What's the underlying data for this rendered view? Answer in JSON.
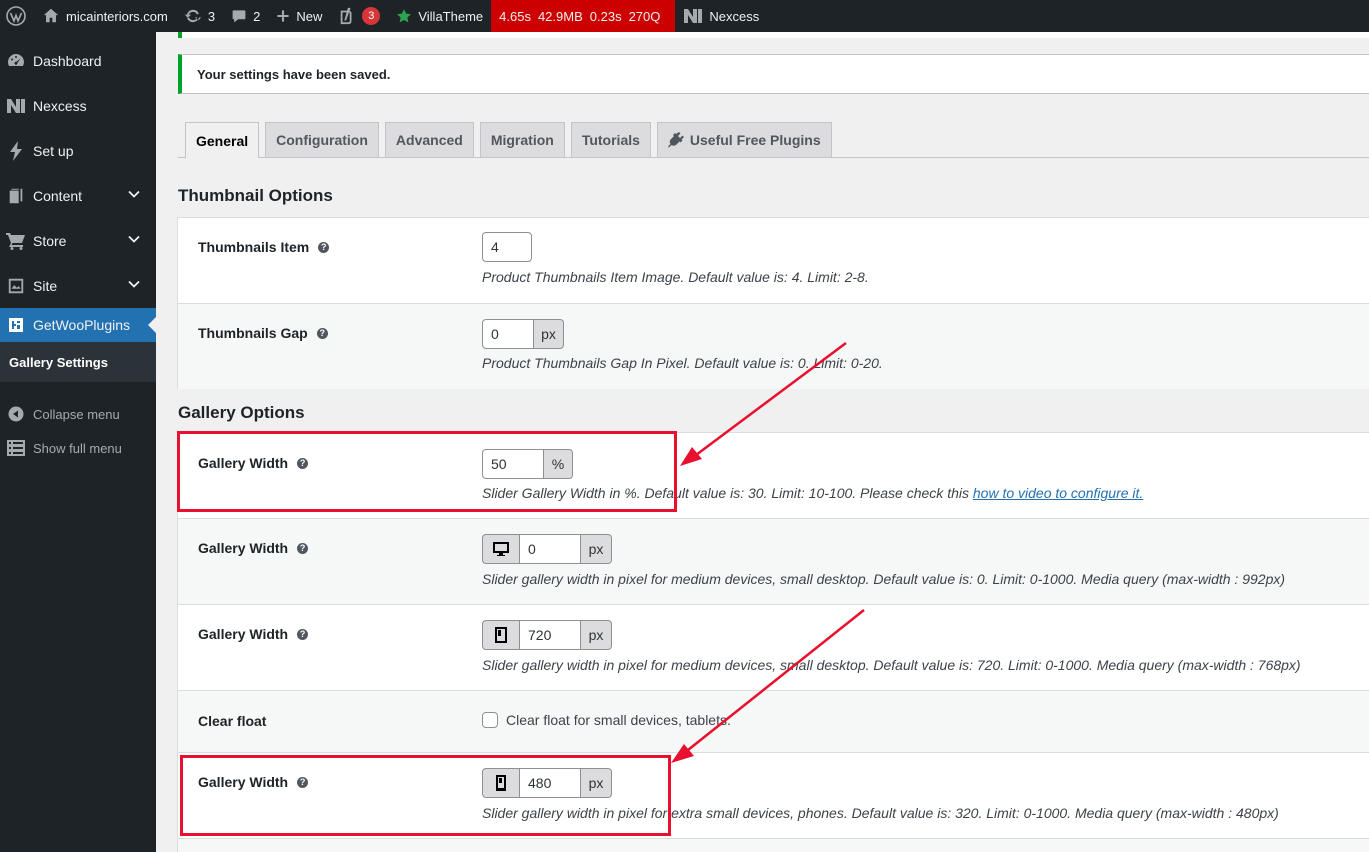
{
  "adminbar": {
    "site_name": "micainteriors.com",
    "updates_count": "3",
    "comments_count": "2",
    "new_label": "New",
    "yoast_badge": "3",
    "villatheme_label": "VillaTheme",
    "perf": [
      "4.65s",
      "42.9MB",
      "0.23s",
      "270Q"
    ],
    "nexcess_label": "Nexcess"
  },
  "sidebar": {
    "items": [
      {
        "label": "Dashboard",
        "icon": "dashboard-icon"
      },
      {
        "label": "Nexcess",
        "icon": "nexcess-icon"
      },
      {
        "label": "Set up",
        "icon": "bolt-icon"
      },
      {
        "label": "Content",
        "icon": "content-icon"
      },
      {
        "label": "Store",
        "icon": "cart-icon"
      },
      {
        "label": "Site",
        "icon": "site-icon"
      },
      {
        "label": "GetWooPlugins",
        "icon": "getwooplugins-icon"
      }
    ],
    "submenu_active": "Gallery Settings",
    "collapse_label": "Collapse menu",
    "full_menu_label": "Show full menu"
  },
  "notice": {
    "text": "Your settings have been saved."
  },
  "tabs": [
    "General",
    "Configuration",
    "Advanced",
    "Migration",
    "Tutorials",
    "Useful Free Plugins"
  ],
  "thumbnail_section": {
    "title": "Thumbnail Options",
    "rows": [
      {
        "label": "Thumbnails Item",
        "value": "4",
        "description": "Product Thumbnails Item Image. Default value is: 4. Limit: 2-8."
      },
      {
        "label": "Thumbnails Gap",
        "value": "0",
        "unit": "px",
        "description": "Product Thumbnails Gap In Pixel. Default value is: 0. Limit: 0-20."
      }
    ]
  },
  "gallery_section": {
    "title": "Gallery Options",
    "rows": [
      {
        "label": "Gallery Width",
        "value": "50",
        "unit": "%",
        "description": "Slider Gallery Width in %. Default value is: 30. Limit: 10-100. Please check this ",
        "link": "how to video to configure it."
      },
      {
        "label": "Gallery Width",
        "value": "0",
        "unit": "px",
        "icon": "desktop-icon",
        "description": "Slider gallery width in pixel for medium devices, small desktop. Default value is: 0. Limit: 0-1000. Media query (max-width : 992px)"
      },
      {
        "label": "Gallery Width",
        "value": "720",
        "unit": "px",
        "icon": "tablet-icon",
        "description": "Slider gallery width in pixel for medium devices, small desktop. Default value is: 720. Limit: 0-1000. Media query (max-width : 768px)"
      },
      {
        "label": "Clear float",
        "checkbox_label": "Clear float for small devices, tablets."
      },
      {
        "label": "Gallery Width",
        "value": "480",
        "unit": "px",
        "icon": "phone-icon",
        "description": "Slider gallery width in pixel for extra small devices, phones. Default value is: 320. Limit: 0-1000. Media query (max-width : 480px)"
      }
    ]
  },
  "colors": {
    "accent": "#2271b1",
    "notice": "#00a32a",
    "annotation": "#e8102e",
    "adminbar": "#1d2327"
  }
}
